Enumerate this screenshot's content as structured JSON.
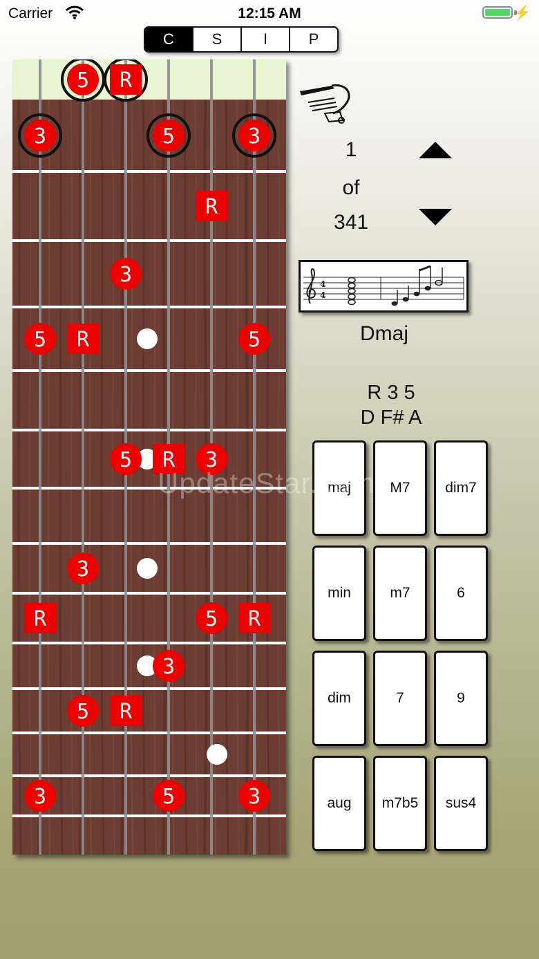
{
  "status_bar": {
    "carrier": "Carrier",
    "time": "12:15 AM"
  },
  "segments": [
    {
      "label": "C",
      "active": true
    },
    {
      "label": "S",
      "active": false
    },
    {
      "label": "I",
      "active": false
    },
    {
      "label": "P",
      "active": false
    }
  ],
  "fretboard": {
    "colors": {
      "wood": "#6b3d33",
      "nut": "#e8f5d3",
      "note": "#ee0000",
      "string": "#8f8f8f",
      "fret": "#ffffff"
    },
    "open_notes": [
      {
        "string": 2,
        "label": "5"
      },
      {
        "string": 3,
        "label": "R"
      }
    ],
    "inlays": [
      3,
      5,
      7,
      9
    ],
    "notes": [
      {
        "string": 1,
        "fret": 1,
        "label": "3",
        "ring": true
      },
      {
        "string": 4,
        "fret": 1,
        "label": "5",
        "ring": true
      },
      {
        "string": 6,
        "fret": 1,
        "label": "3",
        "ring": true
      },
      {
        "string": 5,
        "fret": 2,
        "label": "R"
      },
      {
        "string": 3,
        "fret": 3,
        "label": "3"
      },
      {
        "string": 1,
        "fret": 4,
        "label": "5"
      },
      {
        "string": 2,
        "fret": 4,
        "label": "R"
      },
      {
        "string": 6,
        "fret": 4,
        "label": "5"
      },
      {
        "string": 3,
        "fret": 6,
        "label": "5"
      },
      {
        "string": 4,
        "fret": 6,
        "label": "R"
      },
      {
        "string": 5,
        "fret": 6,
        "label": "3"
      },
      {
        "string": 2,
        "fret": 8,
        "label": "3"
      },
      {
        "string": 1,
        "fret": 9,
        "label": "R"
      },
      {
        "string": 5,
        "fret": 9,
        "label": "5"
      },
      {
        "string": 6,
        "fret": 9,
        "label": "R"
      },
      {
        "string": 4,
        "fret": 10,
        "label": "3"
      },
      {
        "string": 2,
        "fret": 11,
        "label": "5"
      },
      {
        "string": 3,
        "fret": 11,
        "label": "R"
      },
      {
        "string": 1,
        "fret": 13,
        "label": "3"
      },
      {
        "string": 4,
        "fret": 13,
        "label": "5"
      },
      {
        "string": 6,
        "fret": 13,
        "label": "3"
      }
    ]
  },
  "capo_icon": "capo-icon",
  "position": {
    "current": "1",
    "of": "of",
    "total": "341"
  },
  "chord": {
    "name": "Dmaj",
    "intervals": "R 3 5",
    "notes": "D F# A"
  },
  "quality_buttons": [
    "maj",
    "M7",
    "dim7",
    "min",
    "m7",
    "6",
    "dim",
    "7",
    "9",
    "aug",
    "m7b5",
    "sus4"
  ],
  "watermark": "UpdateStar.com"
}
